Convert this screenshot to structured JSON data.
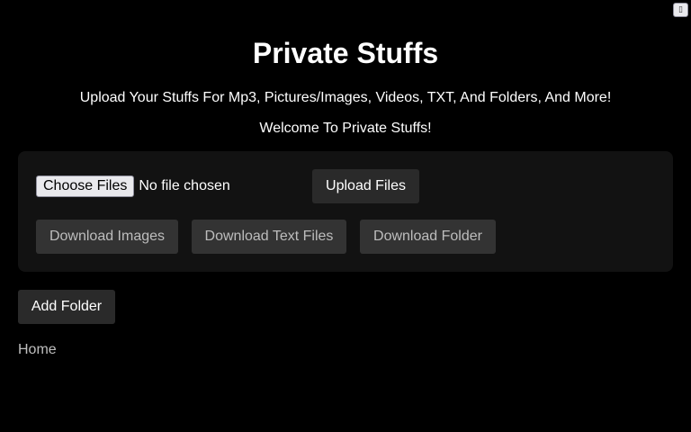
{
  "corner": {
    "icon": "settings-icon",
    "glyph": "▯"
  },
  "header": {
    "title": "Private Stuffs",
    "subtitle": "Upload Your Stuffs For Mp3, Pictures/Images, Videos, TXT, And Folders, And More!",
    "welcome": "Welcome To Private Stuffs!"
  },
  "upload_panel": {
    "choose_label": "Choose Files",
    "file_status": "No file chosen",
    "upload_label": "Upload Files",
    "download_images_label": "Download Images",
    "download_text_label": "Download Text Files",
    "download_folder_label": "Download Folder"
  },
  "actions": {
    "add_folder_label": "Add Folder"
  },
  "breadcrumb": {
    "home_label": "Home"
  }
}
